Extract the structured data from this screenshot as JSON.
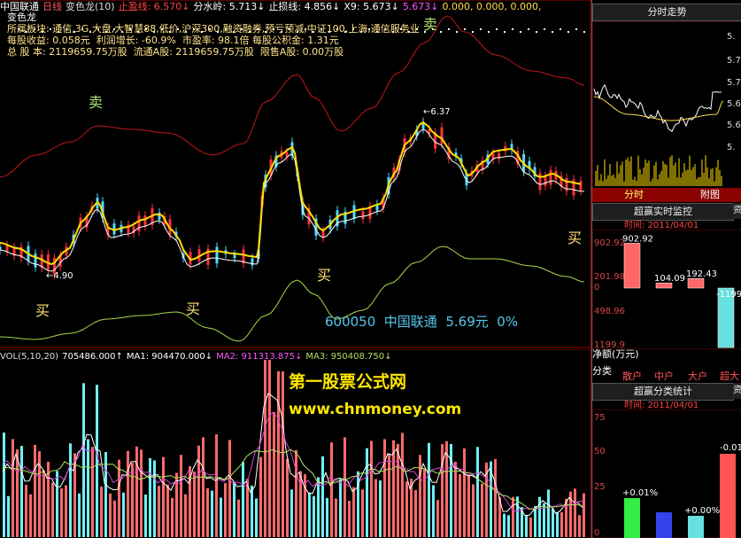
{
  "main_header": {
    "stock_name": "中国联通",
    "period": "日线",
    "indicator": "变色龙(10)",
    "stop_profit": "止盈线: 6.570↓",
    "watershed": "分水岭: 5.713↓",
    "stop_loss": "止损线: 4.856↓",
    "x9": "X9: 5.673↓",
    "x10": "5.673↓",
    "zeros": "0.000, 0.000, 0.000,"
  },
  "info": {
    "label": "变色龙",
    "sector_label": "所属板块:",
    "sectors1": "通信,3G,大盘,大智慧88,低价,沪深300,融资融券,预亏预减,中证100,上海,通信服务业",
    "eps_label": "每股收益:",
    "eps": "0.058元",
    "profit_growth": "利润增长: -60.9%",
    "pe": "市盈率: 98.1倍",
    "reserve": "每股公积金: 1.31元",
    "shares_label": "总 股 本:",
    "total_shares": "2119659.75万股",
    "float": "流通A股: 2119659.75万股",
    "restricted": "限售A股: 0.00万股"
  },
  "signals": {
    "sell": "卖",
    "buy": "买",
    "high_mark": "6.37",
    "low_mark": "4.90"
  },
  "quote_line": "600050  中国联通  5.69元  0%",
  "volume_header": {
    "vol": "VOL(5,10,20)",
    "vol_value": "705486.000↑",
    "ma1": "MA1: 904470.000↓",
    "ma2": "MA2: 911313.875↓",
    "ma3": "MA3: 950408.750↓"
  },
  "watermark": {
    "line1": "第一股票公式网",
    "line2": "www.chnmoney.com"
  },
  "right_panel": {
    "timeshare_title": "分时走势",
    "price_ticks": [
      "5.",
      "5.7",
      "5.7",
      "5.6",
      "5.6",
      "5."
    ],
    "tabs": [
      "分时",
      "附图"
    ],
    "monitor_title": "超赢实时监控",
    "monitor_time": "时间: 2011/04/01",
    "monitor_axis": [
      "902.92",
      "201.98",
      "0",
      "498.96",
      "1199.9"
    ],
    "monitor_bars": [
      {
        "label": "902.92",
        "value": 902.92,
        "color": "#ff6666"
      },
      {
        "label": "104.09",
        "value": 104.09,
        "color": "#ff6666"
      },
      {
        "label": "192.43",
        "value": 192.43,
        "color": "#ff6666"
      },
      {
        "label": "-1199",
        "value": -1199.9,
        "color": "#66e0e0"
      }
    ],
    "net_label": "净额(万元)",
    "category_label": "分类",
    "categories": [
      "散户",
      "中户",
      "大户",
      "超大"
    ],
    "stats_title": "超赢分类统计",
    "stats_time": "时间: 2011/04/01",
    "stats_axis": [
      "75",
      "50",
      "25",
      "0"
    ],
    "stats_labels": [
      "+0.01%",
      "+0.00%",
      "-0.01"
    ],
    "side_tab": "资"
  },
  "colors": {
    "up": "#ff3333",
    "down": "#55d8ff",
    "ma_white": "#ffffff",
    "ma_yellow": "#ffdd00",
    "upper_band": "#c01818",
    "lower_band": "#a8d84a",
    "vol_ma1": "#ffffff",
    "vol_ma2": "#d040d0",
    "vol_ma3": "#b0e060"
  }
}
